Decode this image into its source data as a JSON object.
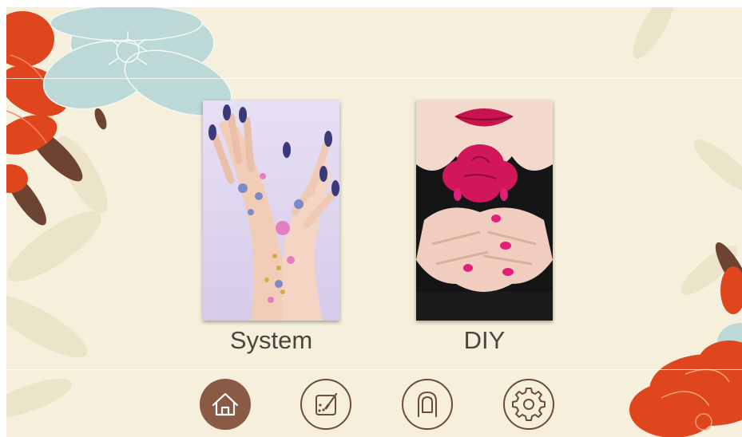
{
  "theme": {
    "background": "#f5efdc",
    "accent_brown": "#8a5a45",
    "flower_red": "#e0461d",
    "flower_teal": "#bcd9d7"
  },
  "cards": [
    {
      "id": "system",
      "label": "System",
      "image": "manicured-hands-floral-nail-art"
    },
    {
      "id": "diy",
      "label": "DIY",
      "image": "lips-rose-pink-nails"
    }
  ],
  "nav": {
    "items": [
      {
        "id": "home",
        "icon": "home-icon",
        "active": true
      },
      {
        "id": "design",
        "icon": "palette-edit-icon",
        "active": false
      },
      {
        "id": "nail",
        "icon": "fingernail-icon",
        "active": false
      },
      {
        "id": "settings",
        "icon": "gear-icon",
        "active": false
      }
    ]
  }
}
